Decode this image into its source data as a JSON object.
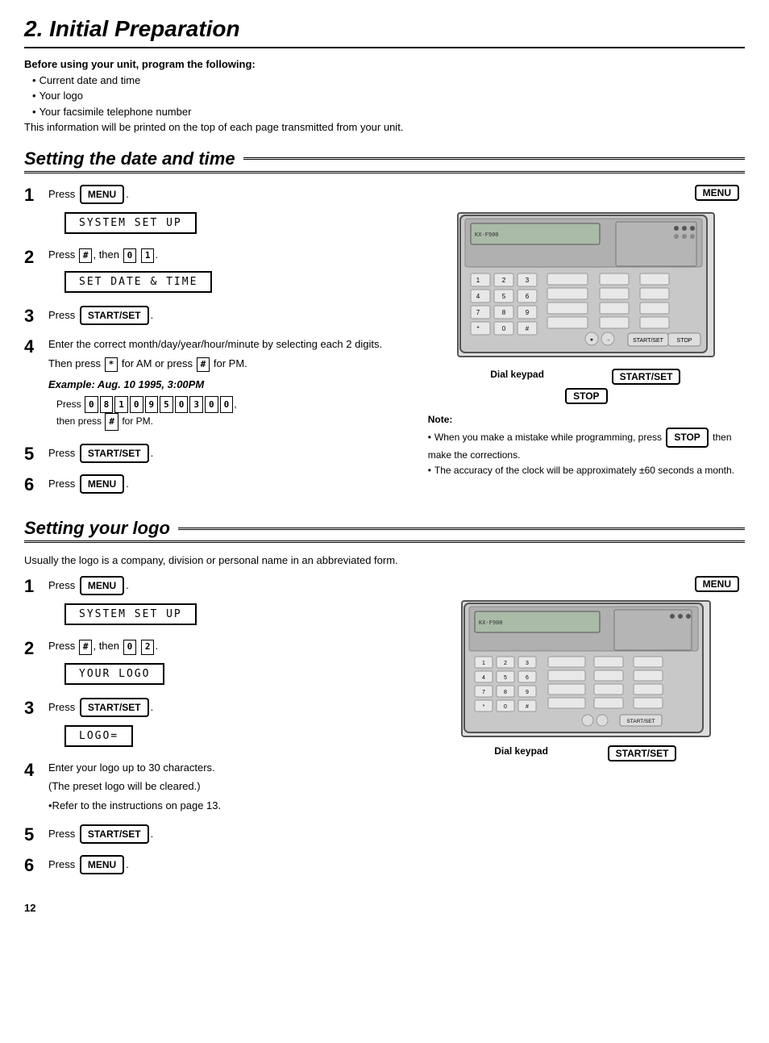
{
  "page": {
    "title_num": "2.",
    "title_text": "Initial Preparation",
    "page_number": "12"
  },
  "intro": {
    "bold_line": "Before using your unit, program the following:",
    "bullets": [
      "Current date and time",
      "Your logo",
      "Your facsimile telephone number"
    ],
    "note": "This information will be printed on the top of each page transmitted from your unit."
  },
  "section1": {
    "title": "Setting the date and time",
    "steps": [
      {
        "num": "1",
        "text": "Press ",
        "button": "MENU",
        "lcd": "SYSTEM SET UP"
      },
      {
        "num": "2",
        "text": "Press ",
        "key1": "#",
        "then": "then",
        "key2a": "0",
        "key2b": "1",
        "lcd": "SET DATE & TIME"
      },
      {
        "num": "3",
        "text": "Press ",
        "button": "START/SET"
      },
      {
        "num": "4",
        "text": "Enter the correct month/day/year/hour/minute by selecting each 2 digits.",
        "line2": "Then press [*] for AM or press [#] for PM.",
        "example_label": "Example: Aug. 10 1995, 3:00PM",
        "example_keys": "Press [0][8][1][0][9][5][0][3][0][0],",
        "example_then": "then press [#] for PM."
      },
      {
        "num": "5",
        "text": "Press ",
        "button": "START/SET"
      },
      {
        "num": "6",
        "text": "Press ",
        "button": "MENU"
      }
    ],
    "note_title": "Note:",
    "notes": [
      "When you make a mistake while programming, press [STOP] then make the corrections.",
      "The accuracy of the clock will be approximately ±60 seconds a month."
    ],
    "diagram_labels": {
      "left": "Dial keypad",
      "right": "START/SET",
      "bottom": "STOP"
    },
    "menu_label": "MENU"
  },
  "section2": {
    "title": "Setting your logo",
    "intro": "Usually the logo is a company, division or personal name in an abbreviated form.",
    "steps": [
      {
        "num": "1",
        "text": "Press ",
        "button": "MENU",
        "lcd": "SYSTEM SET UP"
      },
      {
        "num": "2",
        "text": "Press ",
        "key1": "#",
        "then": "then",
        "key2a": "0",
        "key2b": "2",
        "lcd": "YOUR LOGO"
      },
      {
        "num": "3",
        "text": "Press ",
        "button": "START/SET",
        "lcd": "LOGO="
      },
      {
        "num": "4",
        "text": "Enter your logo up to 30 characters.",
        "line2": "(The preset logo will be cleared.)",
        "bullet": "Refer to the instructions on page 13."
      },
      {
        "num": "5",
        "text": "Press ",
        "button": "START/SET"
      },
      {
        "num": "6",
        "text": "Press ",
        "button": "MENU"
      }
    ],
    "diagram_labels": {
      "left": "Dial keypad",
      "right": "START/SET"
    },
    "menu_label": "MENU"
  }
}
